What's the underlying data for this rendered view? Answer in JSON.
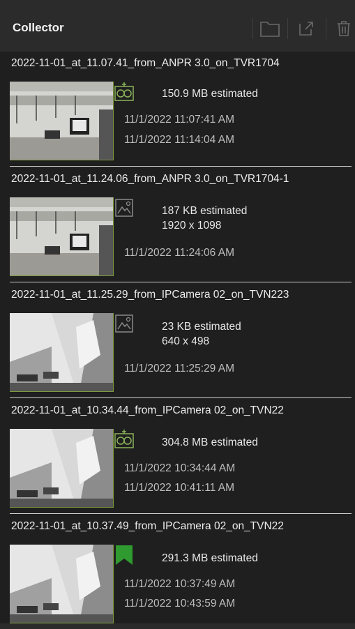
{
  "header": {
    "title": "Collector",
    "icons": [
      "folder-icon",
      "export-icon",
      "trash-icon"
    ]
  },
  "items": [
    {
      "title": "2022-11-01_at_11.07.41_from_ANPR 3.0_on_TVR1704",
      "icon": "recording-icon",
      "size": "150.9 MB estimated",
      "resolution": "",
      "start": "11/1/2022 11:07:41 AM",
      "end": "11/1/2022 11:14:04 AM",
      "thumb": "office"
    },
    {
      "title": "2022-11-01_at_11.24.06_from_ANPR 3.0_on_TVR1704-1",
      "icon": "image-icon",
      "size": "187 KB estimated",
      "resolution": "1920 x 1098",
      "start": "11/1/2022 11:24:06 AM",
      "end": "",
      "thumb": "office"
    },
    {
      "title": "2022-11-01_at_11.25.29_from_IPCamera 02_on_TVN223",
      "icon": "image-icon",
      "size": "23 KB estimated",
      "resolution": "640 x 498",
      "start": "11/1/2022 11:25:29 AM",
      "end": "",
      "thumb": "corridor"
    },
    {
      "title": "2022-11-01_at_10.34.44_from_IPCamera 02_on_TVN22",
      "icon": "recording-icon",
      "size": "304.8 MB estimated",
      "resolution": "",
      "start": "11/1/2022 10:34:44 AM",
      "end": "11/1/2022 10:41:11 AM",
      "thumb": "corridor"
    },
    {
      "title": "2022-11-01_at_10.37.49_from_IPCamera 02_on_TVN22",
      "icon": "bookmark-icon",
      "size": "291.3 MB estimated",
      "resolution": "",
      "start": "11/1/2022 10:37:49 AM",
      "end": "11/1/2022 10:43:59 AM",
      "thumb": "corridor"
    }
  ]
}
